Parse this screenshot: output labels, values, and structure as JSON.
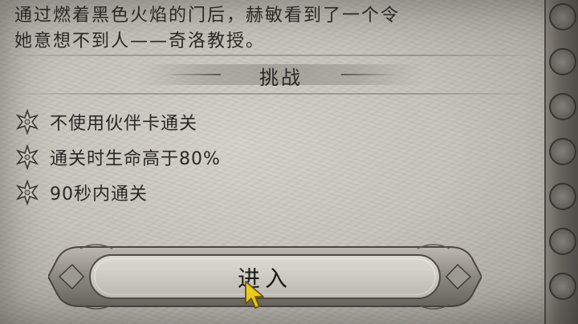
{
  "description": "通过燃着黑色火焰的门后，赫敏看到了一个令\n她意想不到人——奇洛教授。",
  "challenges": {
    "title": "挑战",
    "items": [
      {
        "text": "不使用伙伴卡通关",
        "icon": "star-outline-icon"
      },
      {
        "text": "通关时生命高于80%",
        "icon": "star-outline-icon"
      },
      {
        "text": "90秒内通关",
        "icon": "star-outline-icon"
      }
    ]
  },
  "enter_button": {
    "label": "进入"
  },
  "colors": {
    "text": "#2a2825",
    "paper": "#c6c3bc",
    "frame": "#6f6b65"
  }
}
